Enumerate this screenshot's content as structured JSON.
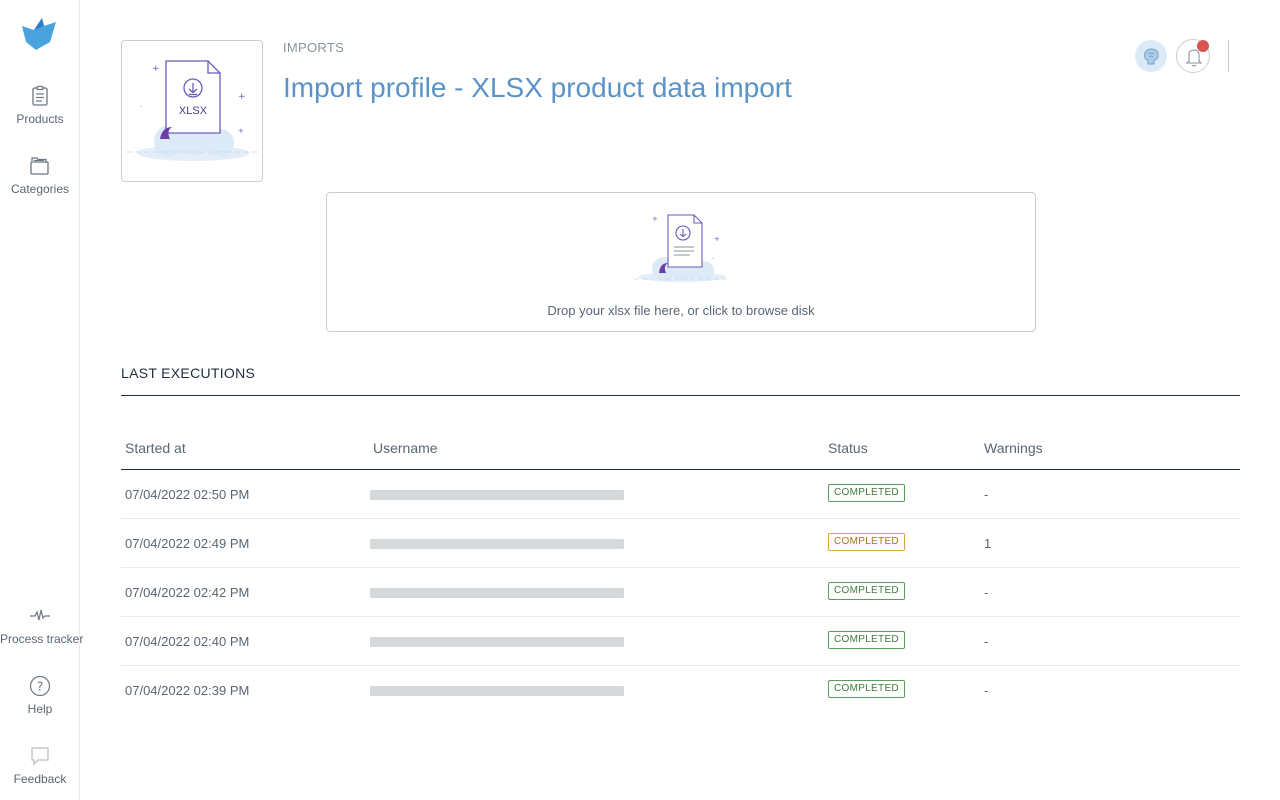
{
  "sidebar": {
    "items": [
      {
        "label": "Products",
        "icon": "clipboard-icon"
      },
      {
        "label": "Categories",
        "icon": "folders-icon"
      },
      {
        "label": "Process tracker",
        "icon": "activity-icon"
      },
      {
        "label": "Help",
        "icon": "help-circle-icon"
      },
      {
        "label": "Feedback",
        "icon": "feedback-icon"
      }
    ]
  },
  "header": {
    "breadcrumb": "IMPORTS",
    "title": "Import profile - XLSX product data import",
    "thumbnail_label": "XLSX"
  },
  "dropzone": {
    "text": "Drop your xlsx file here, or click to browse disk"
  },
  "executions": {
    "title": "LAST EXECUTIONS",
    "columns": [
      "Started at",
      "Username",
      "Status",
      "Warnings"
    ],
    "rows": [
      {
        "started_at": "07/04/2022 02:50 PM",
        "status": "COMPLETED",
        "status_kind": "ok",
        "warnings": "-"
      },
      {
        "started_at": "07/04/2022 02:49 PM",
        "status": "COMPLETED",
        "status_kind": "warn",
        "warnings": "1"
      },
      {
        "started_at": "07/04/2022 02:42 PM",
        "status": "COMPLETED",
        "status_kind": "ok",
        "warnings": "-"
      },
      {
        "started_at": "07/04/2022 02:40 PM",
        "status": "COMPLETED",
        "status_kind": "ok",
        "warnings": "-"
      },
      {
        "started_at": "07/04/2022 02:39 PM",
        "status": "COMPLETED",
        "status_kind": "ok",
        "warnings": "-"
      }
    ]
  },
  "colors": {
    "title": "#5b93c6",
    "status_ok": "#3f7a3f",
    "status_warn": "#a37617",
    "notification_dot": "#d9534f"
  }
}
